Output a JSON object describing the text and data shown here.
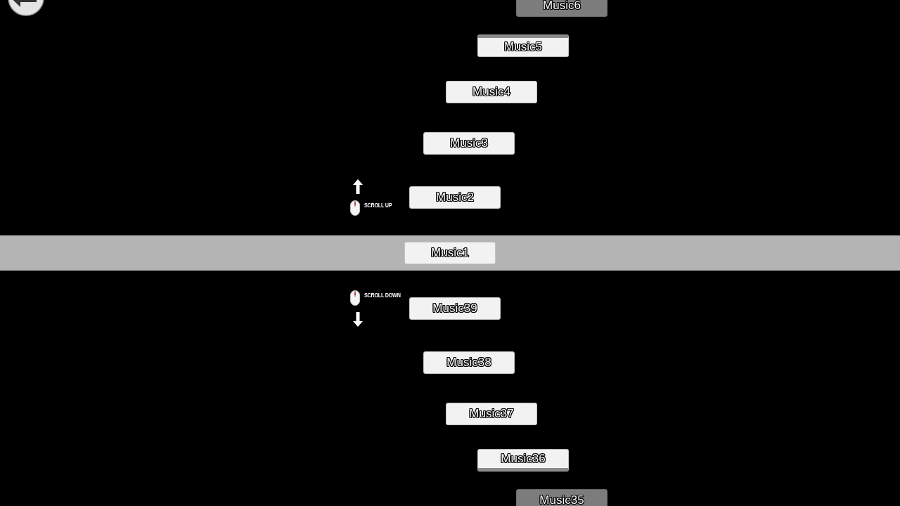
{
  "music_list": {
    "items": [
      {
        "label": "Music6",
        "selected": false
      },
      {
        "label": "Music5",
        "selected": false
      },
      {
        "label": "Music4",
        "selected": false
      },
      {
        "label": "Music3",
        "selected": false
      },
      {
        "label": "Music2",
        "selected": false
      },
      {
        "label": "Music1",
        "selected": true
      },
      {
        "label": "Music39",
        "selected": false
      },
      {
        "label": "Music38",
        "selected": false
      },
      {
        "label": "Music37",
        "selected": false
      },
      {
        "label": "Music36",
        "selected": false
      },
      {
        "label": "Music35",
        "selected": false
      }
    ]
  },
  "scroll_hints": [
    {
      "kind": "up",
      "label": "SCROLL UP"
    },
    {
      "kind": "down",
      "label": "SCROLL DOWN"
    }
  ]
}
